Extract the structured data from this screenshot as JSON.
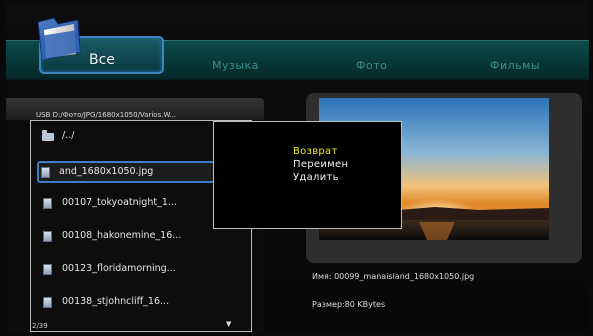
{
  "tabs": {
    "all": "Все",
    "music": "Музыка",
    "photo": "Фото",
    "films": "Фильмы",
    "active": "all"
  },
  "browser": {
    "path": "USB D:/Фото/JPG/1680x1050/Varios.W...",
    "items": [
      {
        "type": "folder",
        "label": "/../"
      },
      {
        "type": "file",
        "label": "and_1680x1050.jpg",
        "selected": true
      },
      {
        "type": "file",
        "label": "00107_tokyoatnight_1..."
      },
      {
        "type": "file",
        "label": "00108_hakonemine_16..."
      },
      {
        "type": "file",
        "label": "00123_floridamorning..."
      },
      {
        "type": "file",
        "label": "00138_stjohncliff_16..."
      }
    ],
    "page": "2/39",
    "scroll_indicator": "▼"
  },
  "context_menu": {
    "items": [
      "Возврат",
      "Переимен",
      "Удалить"
    ],
    "highlighted": "Возврат"
  },
  "preview": {
    "name": "Имя: 00099_manaisland_1680x1050.jpg",
    "size": "Размер:80 KBytes"
  },
  "colors": {
    "tabbar": "#0a4040",
    "focus_border": "#3f7ec4",
    "menu_highlight": "#e8e82a"
  }
}
